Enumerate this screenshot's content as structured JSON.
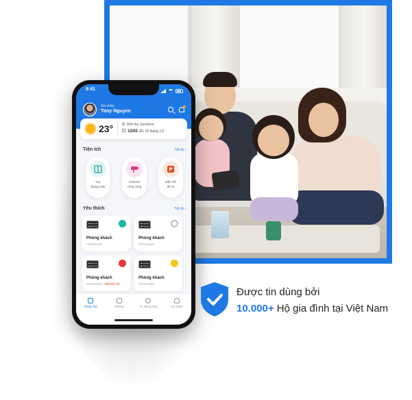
{
  "phone": {
    "status_time": "9:41",
    "greeting": "Xin chào,",
    "user_name": "Tony Nguyen",
    "weather": {
      "temperature": "23°",
      "location": "Biệt thự Sunshine",
      "date": "12/01",
      "lunar_date": "(ÂL 25 tháng 12)"
    },
    "utilities": {
      "title": "Tiện ích",
      "see_all": "Tất cả",
      "items": [
        {
          "label_line1": "Gọi",
          "label_line2": "thang máy",
          "icon": "elevator-icon",
          "color": "#1aa7a0"
        },
        {
          "label_line1": "Camera",
          "label_line2": "công cộng",
          "icon": "camera-icon",
          "color": "#d63d8c"
        },
        {
          "label_line1": "Đặt chỗ",
          "label_line2": "đỗ xe",
          "icon": "parking-icon",
          "color": "#d9501e"
        }
      ]
    },
    "favorites": {
      "title": "Yêu thích",
      "see_all": "Tất cả",
      "items": [
        {
          "name": "Phòng khách",
          "sub": "Thermostat",
          "status_color": "#19b7a8",
          "warning": ""
        },
        {
          "name": "Phòng khách",
          "sub": "Thermostat",
          "status_color": "#b8bcc2",
          "warning": ""
        },
        {
          "name": "Phòng khách",
          "sub": "Thermostat / ",
          "status_color": "#e53935",
          "warning": "Mất kết nối"
        },
        {
          "name": "Phòng khách",
          "sub": "Thermostat",
          "status_color": "#f5c518",
          "warning": ""
        }
      ]
    },
    "tabs": [
      {
        "label": "Trang chủ",
        "icon": "home-icon"
      },
      {
        "label": "Phòng",
        "icon": "door-icon"
      },
      {
        "label": "Tự động hóa",
        "icon": "automation-icon"
      },
      {
        "label": "Cá nhân",
        "icon": "profile-icon"
      }
    ]
  },
  "trust": {
    "line1": "Được tin dùng bởi",
    "count": "10.000+",
    "line2_rest": " Hộ gia đình tại Việt Nam",
    "icon": "shield-check-icon",
    "accent": "#1f79e5"
  }
}
